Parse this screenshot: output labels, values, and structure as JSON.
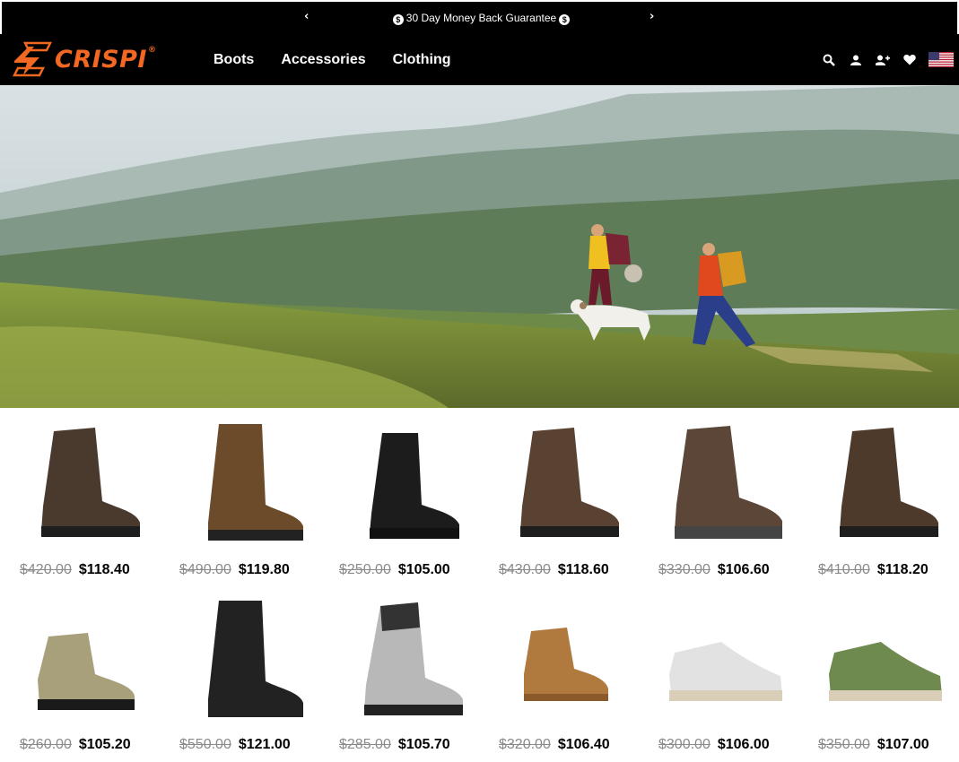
{
  "announcement": {
    "message": "30 Day Money Back Guarantee",
    "prev_icon": "chevron-left-icon",
    "next_icon": "chevron-right-icon",
    "coin_icon": "dollar-coin-icon"
  },
  "brand": {
    "name": "CRISPI",
    "registered_mark": "®",
    "logo_icon": "crispi-logo-icon",
    "color": "#f26722"
  },
  "nav": {
    "items": [
      "Boots",
      "Accessories",
      "Clothing"
    ]
  },
  "header_tools": {
    "icons": [
      "search-icon",
      "account-icon",
      "register-icon",
      "wishlist-icon",
      "us-flag-icon"
    ]
  },
  "hero": {
    "description": "hikers-with-dog-hillside-image"
  },
  "products": [
    {
      "old_price": "$420.00",
      "price": "$118.40",
      "color": "#4a3a2e",
      "style": "hunting-boot"
    },
    {
      "old_price": "$490.00",
      "price": "$119.80",
      "color": "#6b4b2a",
      "style": "tall-boot"
    },
    {
      "old_price": "$250.00",
      "price": "$105.00",
      "color": "#1c1c1c",
      "style": "tactical-boot"
    },
    {
      "old_price": "$430.00",
      "price": "$118.60",
      "color": "#5a4232",
      "style": "hunting-boot"
    },
    {
      "old_price": "$330.00",
      "price": "$106.60",
      "color": "#5b4638",
      "style": "hiking-boot"
    },
    {
      "old_price": "$410.00",
      "price": "$118.20",
      "color": "#4e3a2b",
      "style": "hunting-boot"
    },
    {
      "old_price": "$260.00",
      "price": "$105.20",
      "color": "#a7a07a",
      "style": "hiking-shoe"
    },
    {
      "old_price": "$550.00",
      "price": "$121.00",
      "color": "#222222",
      "style": "tall-boot"
    },
    {
      "old_price": "$285.00",
      "price": "$105.70",
      "color": "#b8b8b8",
      "style": "mountain-boot"
    },
    {
      "old_price": "$320.00",
      "price": "$106.40",
      "color": "#b07a3e",
      "style": "low-boot"
    },
    {
      "old_price": "$300.00",
      "price": "$106.00",
      "color": "#e2e2e2",
      "style": "sneaker"
    },
    {
      "old_price": "$350.00",
      "price": "$107.00",
      "color": "#6f8a4f",
      "style": "sneaker"
    }
  ]
}
